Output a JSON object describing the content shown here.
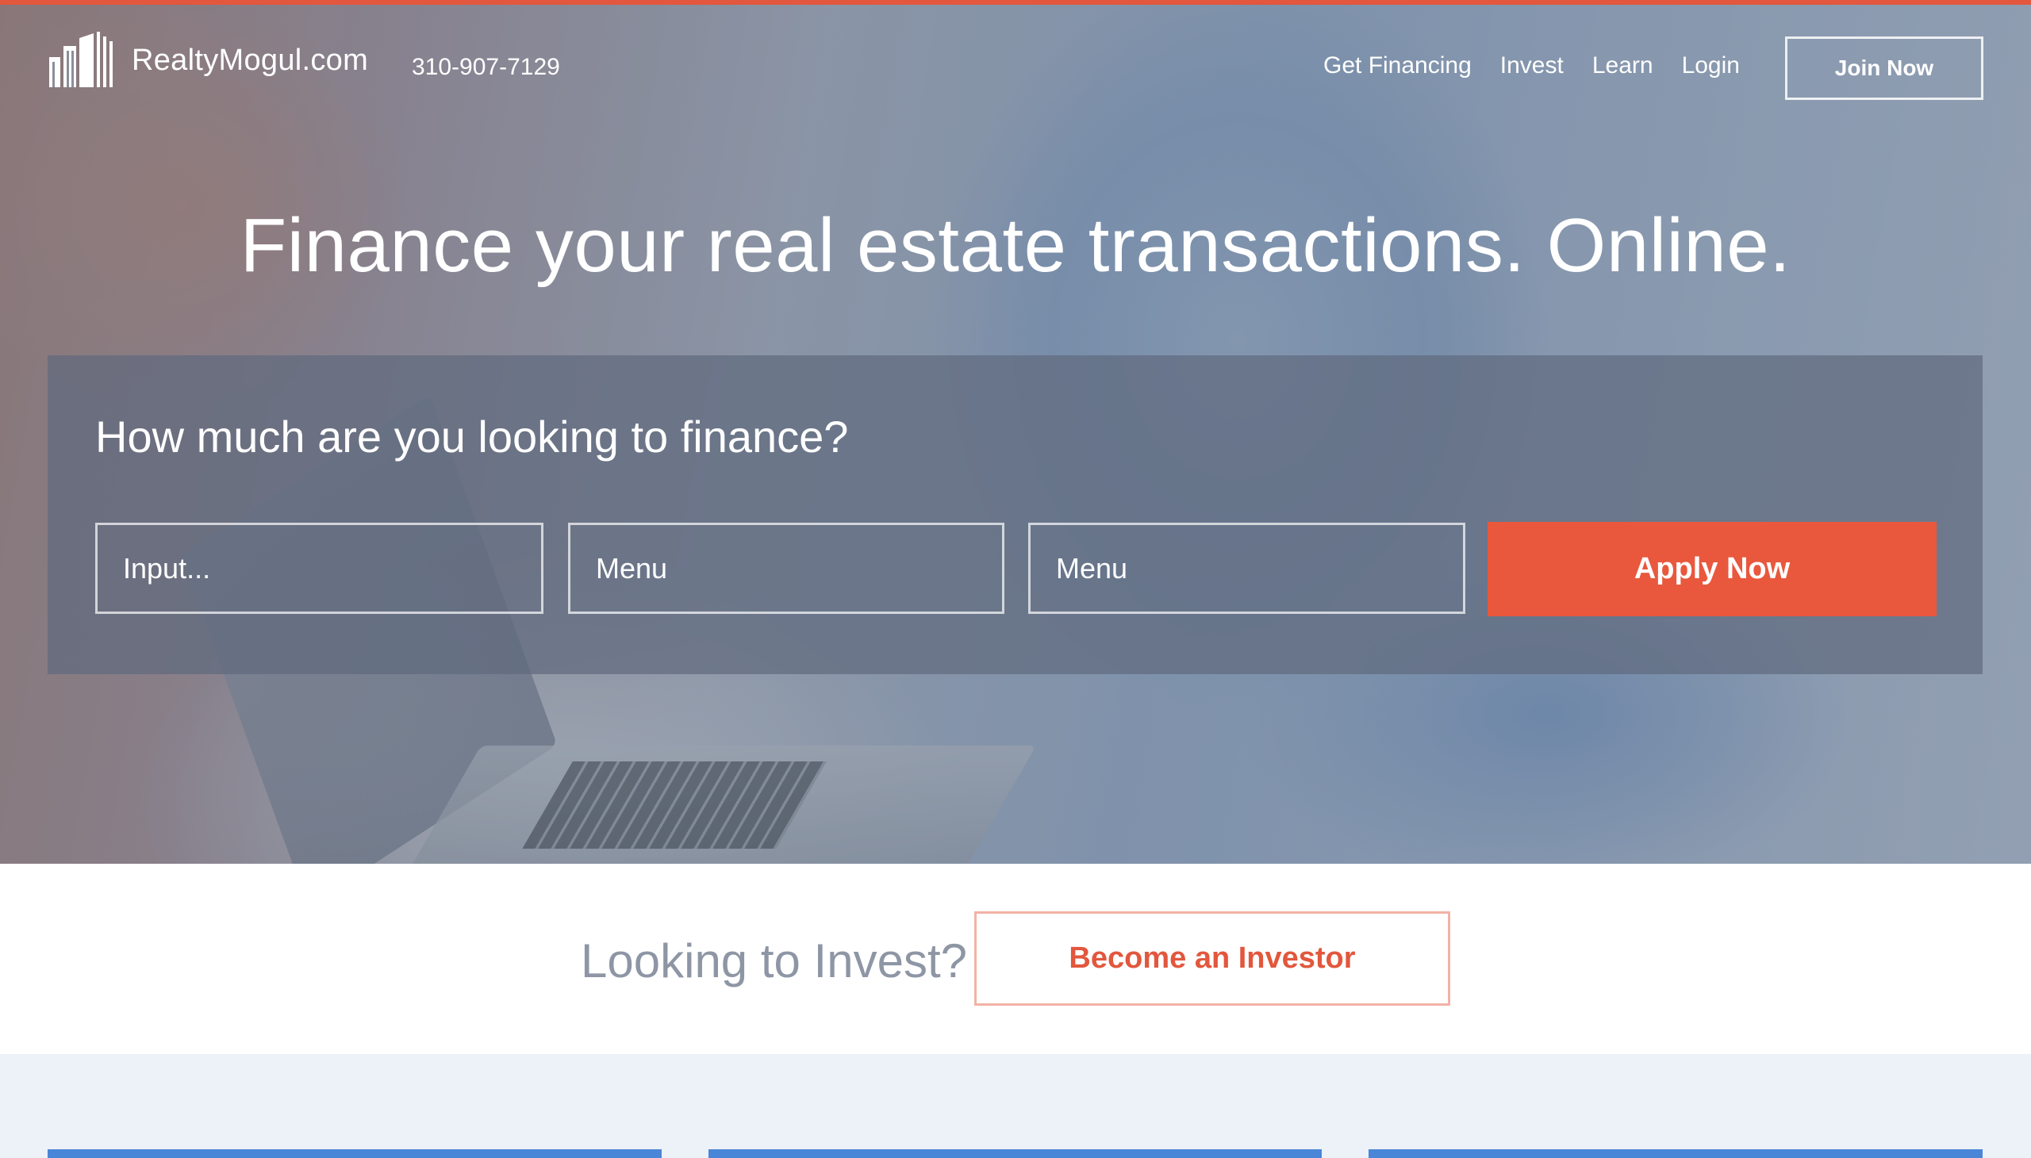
{
  "brand": {
    "name": "RealtyMogul.com",
    "phone": "310-907-7129"
  },
  "nav": {
    "links": [
      "Get Financing",
      "Invest",
      "Learn",
      "Login"
    ],
    "join_label": "Join Now"
  },
  "hero": {
    "headline": "Finance your real estate transactions. Online."
  },
  "finance_form": {
    "title": "How much are you looking to finance?",
    "amount_placeholder": "Input...",
    "menu1_label": "Menu",
    "menu2_label": "Menu",
    "apply_label": "Apply Now"
  },
  "invest": {
    "question": "Looking to Invest?",
    "button_label": "Become an Investor"
  },
  "colors": {
    "accent": "#e9583d",
    "card_blue": "#4a86d8",
    "lower_bg": "#edf1f8"
  },
  "icons": {
    "logo": "buildings-icon"
  }
}
